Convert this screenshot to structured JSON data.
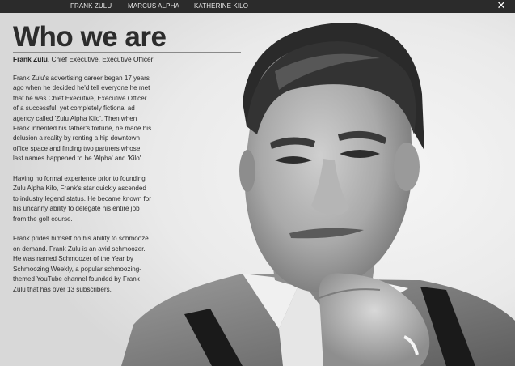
{
  "nav": {
    "tabs": [
      {
        "label": "FRANK ZULU",
        "active": true
      },
      {
        "label": "MARCUS ALPHA",
        "active": false
      },
      {
        "label": "KATHERINE KILO",
        "active": false
      }
    ],
    "close_icon": "close-icon"
  },
  "profile": {
    "heading": "Who we are",
    "name": "Frank Zulu",
    "role": ", Chief Executive, Executive Officer",
    "paragraphs": [
      "Frank Zulu's advertising career began 17 years ago when he decided he'd tell everyone he met that he was Chief Executive, Executive Officer of a successful, yet completely fictional ad agency called 'Zulu Alpha Kilo'. Then when Frank inherited his father's fortune, he made his delusion a reality by renting a hip downtown office space and finding two partners whose last names happened to be 'Alpha' and 'Kilo'.",
      "Having no formal experience prior to founding Zulu Alpha Kilo, Frank's star quickly ascended to industry legend status. He became known for his uncanny ability to delegate his entire job from the golf course.",
      "Frank prides himself on his ability to schmooze on demand. Frank Zulu is an avid schmoozer. He was named Schmoozer of the Year by Schmoozing Weekly, a popular schmoozing-themed YouTube channel founded by Frank Zulu that has over 13 subscribers."
    ]
  },
  "colors": {
    "topbar": "#2b2b2b",
    "heading": "#2c2c2c",
    "text": "#2a2a2a"
  }
}
